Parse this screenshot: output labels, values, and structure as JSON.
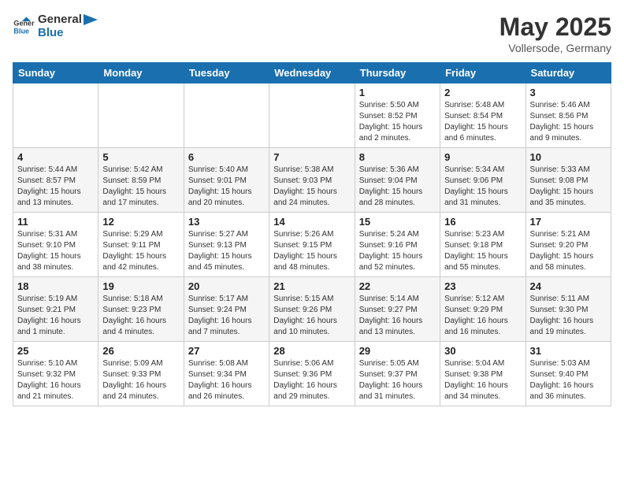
{
  "header": {
    "logo_general": "General",
    "logo_blue": "Blue",
    "month_year": "May 2025",
    "location": "Vollersode, Germany"
  },
  "days_of_week": [
    "Sunday",
    "Monday",
    "Tuesday",
    "Wednesday",
    "Thursday",
    "Friday",
    "Saturday"
  ],
  "weeks": [
    [
      {
        "day": "",
        "sunrise": "",
        "sunset": "",
        "daylight": ""
      },
      {
        "day": "",
        "sunrise": "",
        "sunset": "",
        "daylight": ""
      },
      {
        "day": "",
        "sunrise": "",
        "sunset": "",
        "daylight": ""
      },
      {
        "day": "",
        "sunrise": "",
        "sunset": "",
        "daylight": ""
      },
      {
        "day": "1",
        "sunrise": "Sunrise: 5:50 AM",
        "sunset": "Sunset: 8:52 PM",
        "daylight": "Daylight: 15 hours and 2 minutes."
      },
      {
        "day": "2",
        "sunrise": "Sunrise: 5:48 AM",
        "sunset": "Sunset: 8:54 PM",
        "daylight": "Daylight: 15 hours and 6 minutes."
      },
      {
        "day": "3",
        "sunrise": "Sunrise: 5:46 AM",
        "sunset": "Sunset: 8:56 PM",
        "daylight": "Daylight: 15 hours and 9 minutes."
      }
    ],
    [
      {
        "day": "4",
        "sunrise": "Sunrise: 5:44 AM",
        "sunset": "Sunset: 8:57 PM",
        "daylight": "Daylight: 15 hours and 13 minutes."
      },
      {
        "day": "5",
        "sunrise": "Sunrise: 5:42 AM",
        "sunset": "Sunset: 8:59 PM",
        "daylight": "Daylight: 15 hours and 17 minutes."
      },
      {
        "day": "6",
        "sunrise": "Sunrise: 5:40 AM",
        "sunset": "Sunset: 9:01 PM",
        "daylight": "Daylight: 15 hours and 20 minutes."
      },
      {
        "day": "7",
        "sunrise": "Sunrise: 5:38 AM",
        "sunset": "Sunset: 9:03 PM",
        "daylight": "Daylight: 15 hours and 24 minutes."
      },
      {
        "day": "8",
        "sunrise": "Sunrise: 5:36 AM",
        "sunset": "Sunset: 9:04 PM",
        "daylight": "Daylight: 15 hours and 28 minutes."
      },
      {
        "day": "9",
        "sunrise": "Sunrise: 5:34 AM",
        "sunset": "Sunset: 9:06 PM",
        "daylight": "Daylight: 15 hours and 31 minutes."
      },
      {
        "day": "10",
        "sunrise": "Sunrise: 5:33 AM",
        "sunset": "Sunset: 9:08 PM",
        "daylight": "Daylight: 15 hours and 35 minutes."
      }
    ],
    [
      {
        "day": "11",
        "sunrise": "Sunrise: 5:31 AM",
        "sunset": "Sunset: 9:10 PM",
        "daylight": "Daylight: 15 hours and 38 minutes."
      },
      {
        "day": "12",
        "sunrise": "Sunrise: 5:29 AM",
        "sunset": "Sunset: 9:11 PM",
        "daylight": "Daylight: 15 hours and 42 minutes."
      },
      {
        "day": "13",
        "sunrise": "Sunrise: 5:27 AM",
        "sunset": "Sunset: 9:13 PM",
        "daylight": "Daylight: 15 hours and 45 minutes."
      },
      {
        "day": "14",
        "sunrise": "Sunrise: 5:26 AM",
        "sunset": "Sunset: 9:15 PM",
        "daylight": "Daylight: 15 hours and 48 minutes."
      },
      {
        "day": "15",
        "sunrise": "Sunrise: 5:24 AM",
        "sunset": "Sunset: 9:16 PM",
        "daylight": "Daylight: 15 hours and 52 minutes."
      },
      {
        "day": "16",
        "sunrise": "Sunrise: 5:23 AM",
        "sunset": "Sunset: 9:18 PM",
        "daylight": "Daylight: 15 hours and 55 minutes."
      },
      {
        "day": "17",
        "sunrise": "Sunrise: 5:21 AM",
        "sunset": "Sunset: 9:20 PM",
        "daylight": "Daylight: 15 hours and 58 minutes."
      }
    ],
    [
      {
        "day": "18",
        "sunrise": "Sunrise: 5:19 AM",
        "sunset": "Sunset: 9:21 PM",
        "daylight": "Daylight: 16 hours and 1 minute."
      },
      {
        "day": "19",
        "sunrise": "Sunrise: 5:18 AM",
        "sunset": "Sunset: 9:23 PM",
        "daylight": "Daylight: 16 hours and 4 minutes."
      },
      {
        "day": "20",
        "sunrise": "Sunrise: 5:17 AM",
        "sunset": "Sunset: 9:24 PM",
        "daylight": "Daylight: 16 hours and 7 minutes."
      },
      {
        "day": "21",
        "sunrise": "Sunrise: 5:15 AM",
        "sunset": "Sunset: 9:26 PM",
        "daylight": "Daylight: 16 hours and 10 minutes."
      },
      {
        "day": "22",
        "sunrise": "Sunrise: 5:14 AM",
        "sunset": "Sunset: 9:27 PM",
        "daylight": "Daylight: 16 hours and 13 minutes."
      },
      {
        "day": "23",
        "sunrise": "Sunrise: 5:12 AM",
        "sunset": "Sunset: 9:29 PM",
        "daylight": "Daylight: 16 hours and 16 minutes."
      },
      {
        "day": "24",
        "sunrise": "Sunrise: 5:11 AM",
        "sunset": "Sunset: 9:30 PM",
        "daylight": "Daylight: 16 hours and 19 minutes."
      }
    ],
    [
      {
        "day": "25",
        "sunrise": "Sunrise: 5:10 AM",
        "sunset": "Sunset: 9:32 PM",
        "daylight": "Daylight: 16 hours and 21 minutes."
      },
      {
        "day": "26",
        "sunrise": "Sunrise: 5:09 AM",
        "sunset": "Sunset: 9:33 PM",
        "daylight": "Daylight: 16 hours and 24 minutes."
      },
      {
        "day": "27",
        "sunrise": "Sunrise: 5:08 AM",
        "sunset": "Sunset: 9:34 PM",
        "daylight": "Daylight: 16 hours and 26 minutes."
      },
      {
        "day": "28",
        "sunrise": "Sunrise: 5:06 AM",
        "sunset": "Sunset: 9:36 PM",
        "daylight": "Daylight: 16 hours and 29 minutes."
      },
      {
        "day": "29",
        "sunrise": "Sunrise: 5:05 AM",
        "sunset": "Sunset: 9:37 PM",
        "daylight": "Daylight: 16 hours and 31 minutes."
      },
      {
        "day": "30",
        "sunrise": "Sunrise: 5:04 AM",
        "sunset": "Sunset: 9:38 PM",
        "daylight": "Daylight: 16 hours and 34 minutes."
      },
      {
        "day": "31",
        "sunrise": "Sunrise: 5:03 AM",
        "sunset": "Sunset: 9:40 PM",
        "daylight": "Daylight: 16 hours and 36 minutes."
      }
    ]
  ]
}
